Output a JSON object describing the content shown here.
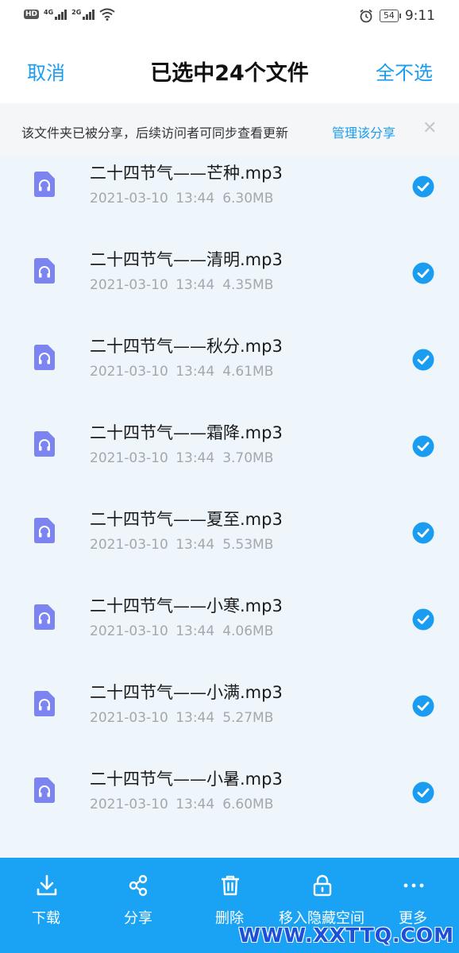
{
  "status_bar": {
    "hd": "HD",
    "net1": "4G",
    "net2": "2G",
    "battery": "54",
    "time": "9:11"
  },
  "header": {
    "cancel_label": "取消",
    "title": "已选中24个文件",
    "deselect_label": "全不选"
  },
  "banner": {
    "text": "该文件夹已被分享，后续访问者可同步查看更新",
    "link": "管理该分享",
    "close": "✕"
  },
  "files": [
    {
      "name": "二十四节气——芒种.mp3",
      "date": "2021-03-10 13:44",
      "size": "6.30MB",
      "selected": true
    },
    {
      "name": "二十四节气——清明.mp3",
      "date": "2021-03-10 13:44",
      "size": "4.35MB",
      "selected": true
    },
    {
      "name": "二十四节气——秋分.mp3",
      "date": "2021-03-10 13:44",
      "size": "4.61MB",
      "selected": true
    },
    {
      "name": "二十四节气——霜降.mp3",
      "date": "2021-03-10 13:44",
      "size": "3.70MB",
      "selected": true
    },
    {
      "name": "二十四节气——夏至.mp3",
      "date": "2021-03-10 13:44",
      "size": "5.53MB",
      "selected": true
    },
    {
      "name": "二十四节气——小寒.mp3",
      "date": "2021-03-10 13:44",
      "size": "4.06MB",
      "selected": true
    },
    {
      "name": "二十四节气——小满.mp3",
      "date": "2021-03-10 13:44",
      "size": "5.27MB",
      "selected": true
    },
    {
      "name": "二十四节气——小暑.mp3",
      "date": "2021-03-10 13:44",
      "size": "6.60MB",
      "selected": true
    }
  ],
  "toolbar": {
    "download": "下载",
    "share": "分享",
    "delete": "删除",
    "move_hidden": "移入隐藏空间",
    "more": "更多"
  },
  "watermark": "WWW.XXTTQ.COM",
  "colors": {
    "accent": "#1a9df0",
    "toolbar_bg": "#1aa3f5",
    "file_icon": "#7b84f0",
    "check": "#1a9df0",
    "list_bg": "#eef6fb"
  },
  "icons": {
    "file": "audio-file-icon",
    "check": "check-circle-icon",
    "download": "download-icon",
    "share": "share-icon",
    "delete": "trash-icon",
    "move_hidden": "lock-icon",
    "more": "more-dots-icon"
  }
}
